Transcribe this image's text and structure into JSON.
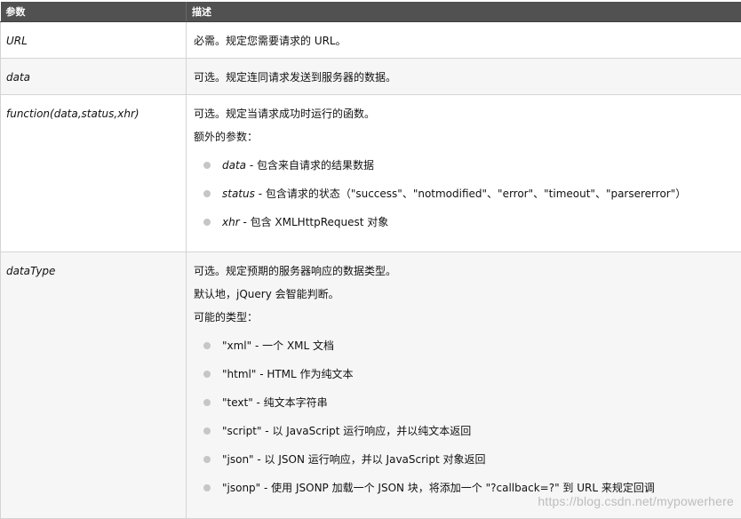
{
  "header": {
    "param": "参数",
    "desc": "描述"
  },
  "rows": [
    {
      "param": "URL",
      "lines": [
        "必需。规定您需要请求的 URL。"
      ]
    },
    {
      "param": "data",
      "lines": [
        "可选。规定连同请求发送到服务器的数据。"
      ]
    },
    {
      "param": "function(data,status,xhr)",
      "lines": [
        "可选。规定当请求成功时运行的函数。",
        "额外的参数："
      ],
      "bullets": [
        {
          "term": "data",
          "text": " - 包含来自请求的结果数据"
        },
        {
          "term": "status",
          "text": " - 包含请求的状态（\"success\"、\"notmodified\"、\"error\"、\"timeout\"、\"parsererror\"）"
        },
        {
          "term": "xhr",
          "text": " - 包含 XMLHttpRequest 对象"
        }
      ]
    },
    {
      "param": "dataType",
      "lines": [
        "可选。规定预期的服务器响应的数据类型。",
        "默认地，jQuery 会智能判断。",
        "可能的类型："
      ],
      "bullets": [
        {
          "text": "\"xml\" - 一个 XML 文档"
        },
        {
          "text": "\"html\" - HTML 作为纯文本"
        },
        {
          "text": "\"text\" - 纯文本字符串"
        },
        {
          "text": "\"script\" - 以 JavaScript 运行响应，并以纯文本返回"
        },
        {
          "text": "\"json\" - 以 JSON 运行响应，并以 JavaScript 对象返回"
        },
        {
          "text": "\"jsonp\" - 使用 JSONP 加载一个 JSON 块，将添加一个 \"?callback=?\" 到 URL 来规定回调"
        }
      ]
    }
  ],
  "watermark": "https://blog.csdn.net/mypowerhere"
}
